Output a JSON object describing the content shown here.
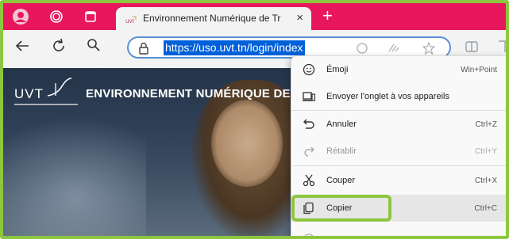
{
  "browser": {
    "tab": {
      "title": "Environnement Numérique de Tr",
      "close_glyph": "×"
    },
    "new_tab_glyph": "+",
    "address_bar": {
      "url": "https://uso.uvt.tn/login/index.php",
      "url_visible": "https://uso.uvt.tn/login/index"
    },
    "accent_color": "#e8175d"
  },
  "page": {
    "logo_text": "UVT",
    "heading": "ENVIRONNEMENT NUMÉRIQUE DE TRAVAIL"
  },
  "context_menu": {
    "items": [
      {
        "label": "Émoji",
        "shortcut": "Win+Point",
        "icon": "emoji-icon",
        "enabled": true
      },
      {
        "label": "Envoyer l'onglet à vos appareils",
        "shortcut": "",
        "icon": "send-to-devices-icon",
        "enabled": true
      },
      {
        "label": "Annuler",
        "shortcut": "Ctrl+Z",
        "icon": "undo-icon",
        "enabled": true
      },
      {
        "label": "Rétablir",
        "shortcut": "Ctrl+Y",
        "icon": "redo-icon",
        "enabled": false
      },
      {
        "label": "Couper",
        "shortcut": "Ctrl+X",
        "icon": "scissors-icon",
        "enabled": true
      },
      {
        "label": "Copier",
        "shortcut": "Ctrl+C",
        "icon": "copy-icon",
        "enabled": true,
        "highlighted": true
      }
    ]
  },
  "highlight_color": "#8dc63f"
}
